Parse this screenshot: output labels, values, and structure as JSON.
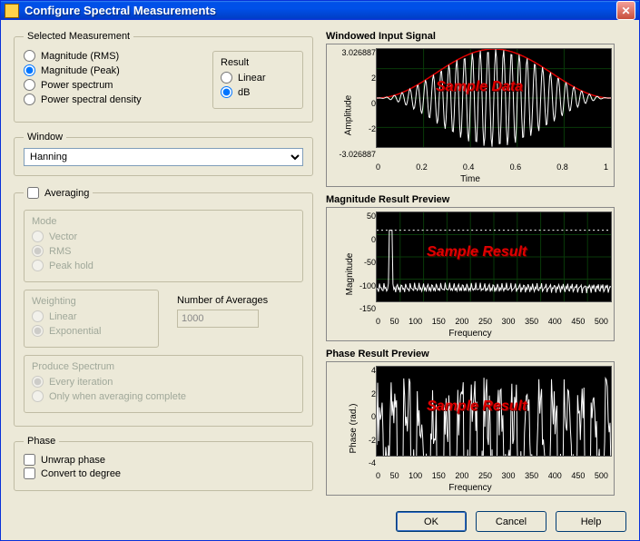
{
  "titlebar": {
    "title": "Configure Spectral Measurements"
  },
  "selected_measurement": {
    "legend": "Selected Measurement",
    "options": [
      "Magnitude (RMS)",
      "Magnitude (Peak)",
      "Power spectrum",
      "Power spectral density"
    ],
    "selected": "Magnitude (Peak)"
  },
  "result": {
    "legend": "Result",
    "options": [
      "Linear",
      "dB"
    ],
    "selected": "dB"
  },
  "window": {
    "legend": "Window",
    "value": "Hanning"
  },
  "averaging": {
    "legend": "Averaging",
    "checked": false,
    "mode": {
      "legend": "Mode",
      "options": [
        "Vector",
        "RMS",
        "Peak hold"
      ],
      "selected": "RMS"
    },
    "weighting": {
      "legend": "Weighting",
      "options": [
        "Linear",
        "Exponential"
      ],
      "selected": "Exponential"
    },
    "num_averages": {
      "legend": "Number of Averages",
      "value": "1000"
    },
    "produce": {
      "legend": "Produce Spectrum",
      "options": [
        "Every iteration",
        "Only when averaging complete"
      ],
      "selected": "Every iteration"
    }
  },
  "phase": {
    "legend": "Phase",
    "unwrap": {
      "label": "Unwrap phase",
      "checked": false
    },
    "degree": {
      "label": "Convert to degree",
      "checked": false
    }
  },
  "preview": {
    "windowed": {
      "title": "Windowed Input Signal",
      "ylabel": "Amplitude",
      "xlabel": "Time",
      "overlay": "Sample Data"
    },
    "magnitude": {
      "title": "Magnitude Result Preview",
      "ylabel": "Magnitude",
      "xlabel": "Frequency",
      "overlay": "Sample Result"
    },
    "phase": {
      "title": "Phase Result Preview",
      "ylabel": "Phase (rad.)",
      "xlabel": "Frequency",
      "overlay": "Sample Result"
    }
  },
  "buttons": {
    "ok": "OK",
    "cancel": "Cancel",
    "help": "Help"
  },
  "chart_data": [
    {
      "type": "line",
      "title": "Windowed Input Signal",
      "xlabel": "Time",
      "ylabel": "Amplitude",
      "xlim": [
        0,
        1
      ],
      "ylim": [
        -3.026887,
        3.026887
      ],
      "xticks": [
        0,
        0.2,
        0.4,
        0.6,
        0.8,
        1
      ],
      "yticks": [
        -3.026887,
        -2,
        0,
        2,
        3.026887
      ],
      "series": [
        {
          "name": "envelope",
          "color": "#E00000",
          "shape": "hann_window_peak_3.026887"
        },
        {
          "name": "signal",
          "color": "#FFFFFF",
          "shape": "sine_30Hz_windowed_hann"
        }
      ],
      "annotation": "Sample Data"
    },
    {
      "type": "line",
      "title": "Magnitude Result Preview",
      "xlabel": "Frequency",
      "ylabel": "Magnitude",
      "xlim": [
        0,
        500
      ],
      "ylim": [
        -150,
        50
      ],
      "xticks": [
        0,
        50,
        100,
        150,
        200,
        250,
        300,
        350,
        400,
        450,
        500
      ],
      "yticks": [
        -150,
        -100,
        -50,
        0,
        50
      ],
      "series": [
        {
          "name": "reference",
          "color": "#FFFFFF",
          "style": "dashed",
          "y_const": 10
        },
        {
          "name": "magnitude",
          "color": "#FFFFFF",
          "peak_freq": 30,
          "peak_value": 10,
          "floor_approx": -120
        }
      ],
      "annotation": "Sample Result"
    },
    {
      "type": "line",
      "title": "Phase Result Preview",
      "xlabel": "Frequency",
      "ylabel": "Phase (rad.)",
      "xlim": [
        0,
        500
      ],
      "ylim": [
        -4,
        4
      ],
      "xticks": [
        0,
        50,
        100,
        150,
        200,
        250,
        300,
        350,
        400,
        450,
        500
      ],
      "yticks": [
        -4,
        -2,
        0,
        2,
        4
      ],
      "series": [
        {
          "name": "phase",
          "color": "#FFFFFF",
          "shape": "noise_uniform_-pi_pi"
        }
      ],
      "annotation": "Sample Result"
    }
  ]
}
